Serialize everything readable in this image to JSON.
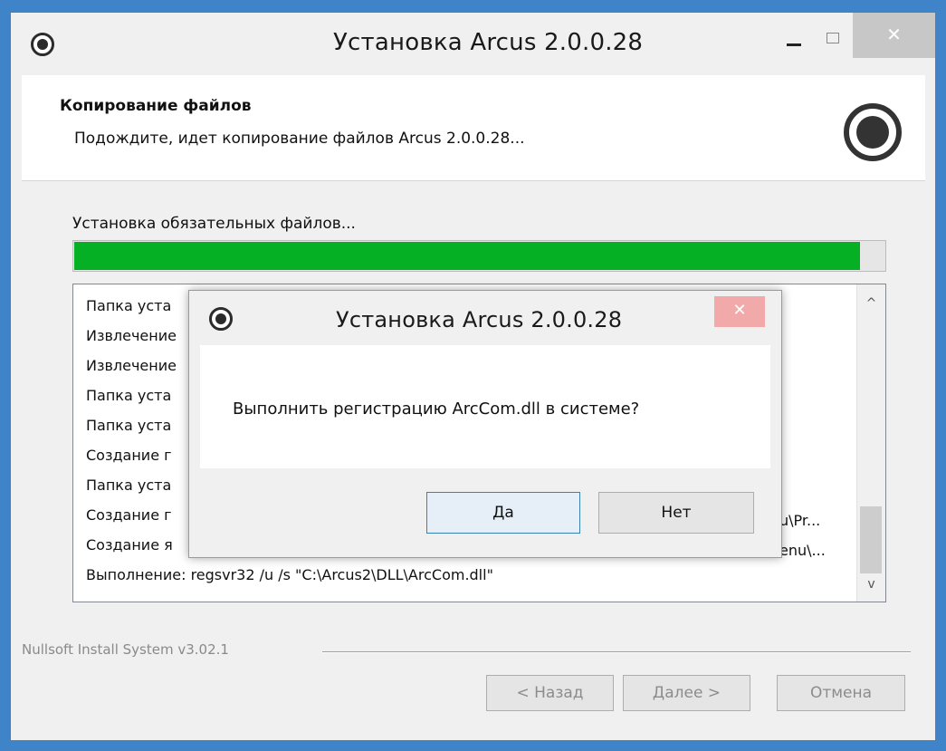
{
  "window": {
    "title": "Установка Arcus 2.0.0.28",
    "close_glyph": "✕"
  },
  "header": {
    "title": "Копирование файлов",
    "subtitle": "Подождите, идет копирование файлов Arcus 2.0.0.28..."
  },
  "progress": {
    "label": "Установка обязательных файлов...",
    "fraction": 0.97,
    "color": "#06b025"
  },
  "log": {
    "lines": [
      "Папка уста",
      "Извлечение",
      "Извлечение",
      "Папка уста",
      "Папка уста",
      "Создание г",
      "Папка уста",
      "Создание г",
      "Создание я",
      "Выполнение: regsvr32 /u /s \"C:\\Arcus2\\DLL\\ArcCom.dll\""
    ],
    "tail_fragments": {
      "7": "u\\Pr...",
      "8": "enu\\..."
    },
    "scroll_up_glyph": "^",
    "scroll_down_glyph": "v"
  },
  "footer": {
    "brand": "Nullsoft Install System v3.02.1",
    "back_label": "< Назад",
    "next_label": "Далее >",
    "cancel_label": "Отмена"
  },
  "modal": {
    "title": "Установка Arcus 2.0.0.28",
    "close_glyph": "✕",
    "message": "Выполнить регистрацию ArcCom.dll в системе?",
    "yes_label": "Да",
    "no_label": "Нет"
  }
}
